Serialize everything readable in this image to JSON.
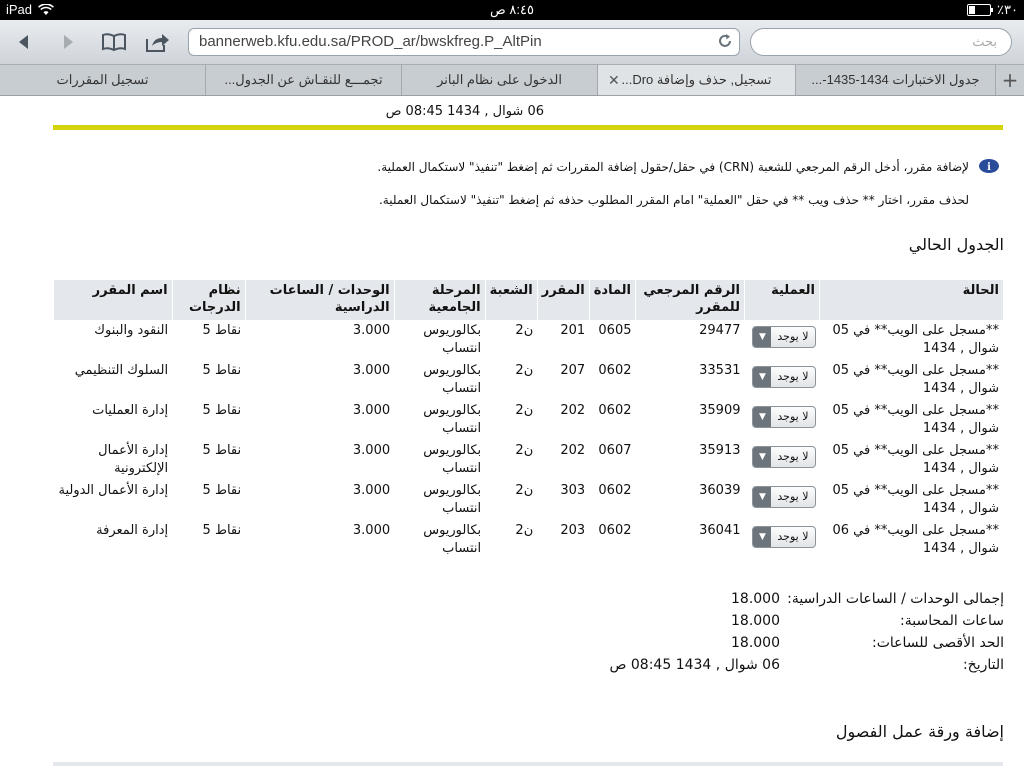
{
  "status": {
    "device": "iPad",
    "time": "٨:٤٥ ص",
    "battery": "٪٣٠"
  },
  "browser": {
    "url": "bannerweb.kfu.edu.sa/PROD_ar/bwskfreg.P_AltPin",
    "search_placeholder": "بحث",
    "tabs": [
      {
        "label": "جدول الاختبارات 1434-1435-..."
      },
      {
        "label": "تسجيل, حذف وإضافة Dro..."
      },
      {
        "label": "الدخول على نظام البانر"
      },
      {
        "label": "تجمـــع للنقـاش عن الجدول..."
      },
      {
        "label": "تسجيل المقررات"
      }
    ]
  },
  "page": {
    "header_date": "06 شوال , 1434 08:45 ص",
    "instruction_add": "لإضافة مقرر، أدخل الرقم المرجعي للشعبة (CRN) في حقل/حقول إضافة المقررات ثم إضغط \"تنفيذ\" لاستكمال العملية.",
    "instruction_drop": "لحذف مقرر، اختار ** حذف ويب ** في حقل \"العملية\" امام المقرر المطلوب حذفه ثم إضغط \"تنفيذ\" لاستكمال العملية.",
    "current_schedule_title": "الجدول الحالي",
    "columns": {
      "status": "الحالة",
      "action": "العملية",
      "crn": "الرقم المرجعي للمقرر",
      "subject": "المادة",
      "course": "المقرر",
      "section": "الشعبة",
      "level": "المرحلة الجامعية",
      "credits": "الوحدات / الساعات الدراسية",
      "grade_mode": "نظام الدرجات",
      "title": "اسم المقرر"
    },
    "rows": [
      {
        "status": "**مسجل على الويب** في 05 شوال , 1434",
        "action": "لا يوجد",
        "crn": "29477",
        "subject": "0605",
        "course": "201",
        "section": "ن2",
        "level": "بكالوريوس انتساب",
        "credits": "3.000",
        "grade_mode": "نقاط 5",
        "title": "النقود والبنوك"
      },
      {
        "status": "**مسجل على الويب** في 05 شوال , 1434",
        "action": "لا يوجد",
        "crn": "33531",
        "subject": "0602",
        "course": "207",
        "section": "ن2",
        "level": "بكالوريوس انتساب",
        "credits": "3.000",
        "grade_mode": "نقاط 5",
        "title": "السلوك التنظيمي"
      },
      {
        "status": "**مسجل على الويب** في 05 شوال , 1434",
        "action": "لا يوجد",
        "crn": "35909",
        "subject": "0602",
        "course": "202",
        "section": "ن2",
        "level": "بكالوريوس انتساب",
        "credits": "3.000",
        "grade_mode": "نقاط 5",
        "title": "إدارة العمليات"
      },
      {
        "status": "**مسجل على الويب** في 05 شوال , 1434",
        "action": "لا يوجد",
        "crn": "35913",
        "subject": "0607",
        "course": "202",
        "section": "ن2",
        "level": "بكالوريوس انتساب",
        "credits": "3.000",
        "grade_mode": "نقاط 5",
        "title": "إدارة الأعمال الإلكترونية"
      },
      {
        "status": "**مسجل على الويب** في 05 شوال , 1434",
        "action": "لا يوجد",
        "crn": "36039",
        "subject": "0602",
        "course": "303",
        "section": "ن2",
        "level": "بكالوريوس انتساب",
        "credits": "3.000",
        "grade_mode": "نقاط 5",
        "title": "إدارة الأعمال الدولية"
      },
      {
        "status": "**مسجل على الويب** في 06 شوال , 1434",
        "action": "لا يوجد",
        "crn": "36041",
        "subject": "0602",
        "course": "203",
        "section": "ن2",
        "level": "بكالوريوس انتساب",
        "credits": "3.000",
        "grade_mode": "نقاط 5",
        "title": "إدارة المعرفة"
      }
    ],
    "totals": {
      "total_credits_label": "إجمالى الوحدات / الساعات الدراسية:",
      "total_credits": "18.000",
      "billing_label": "ساعات المحاسبة:",
      "billing": "18.000",
      "max_label": "الحد الأقصى للساعات:",
      "max": "18.000",
      "date_label": "التاريخ:",
      "date": "06 شوال , 1434 08:45 ص"
    },
    "add_worksheet_title": "إضافة ورقة عمل الفصول"
  },
  "colors": {
    "accent_rule": "#d4d40d",
    "header_bg": "#e4e8ec"
  }
}
